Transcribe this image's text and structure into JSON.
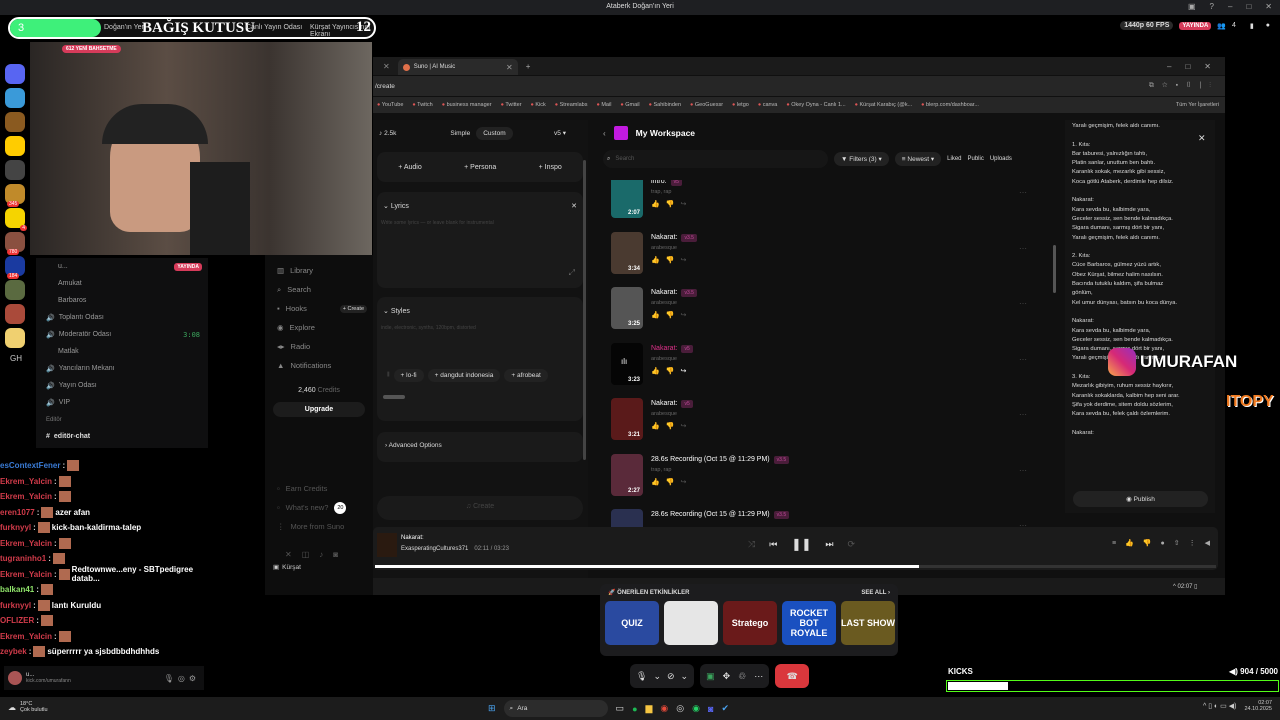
{
  "discord_title": "Ataberk Doğan'ın Yeri",
  "donation": {
    "left_value": "3",
    "title": "BAĞIŞ KUTUSU",
    "right_value": "12",
    "progress_fraction": 0.25,
    "crumbs": [
      "Doğan'ın Yeri",
      "Canlı Yayın Odası",
      "Kürşat Yayıncısının Ekranı"
    ]
  },
  "stream": {
    "quality": "1440p 60 FPS",
    "live": "YAYINDA",
    "viewers": "4",
    "new_sub": "612 YENİ BAHSETME"
  },
  "servers": {
    "badges": [
      "345",
      "4",
      "780",
      "184"
    ],
    "gh": "GH"
  },
  "channels": {
    "live_badge": "YAYINDA",
    "users": [
      "u...",
      "Amukat",
      "Barbaros"
    ],
    "rooms": [
      {
        "name": "Toplantı Odası"
      },
      {
        "name": "Moderatör Odası",
        "time": "3:08"
      },
      {
        "name": "Matlak",
        "user": true
      },
      {
        "name": "Yancıların Mekanı"
      },
      {
        "name": "Yayın Odası"
      },
      {
        "name": "VIP"
      }
    ],
    "category": "Editör",
    "text_channel": "editör-chat"
  },
  "chat": [
    {
      "user": "esContextFener",
      "color": "u-blue",
      "text": ""
    },
    {
      "user": "Ekrem_Yalcin",
      "color": "u-red",
      "text": ""
    },
    {
      "user": "Ekrem_Yalcin",
      "color": "u-red",
      "text": ""
    },
    {
      "user": "eren1077",
      "color": "u-red",
      "text": "azer afan"
    },
    {
      "user": "furknyyl",
      "color": "u-red",
      "text": "kick-ban-kaldirma-talep"
    },
    {
      "user": "Ekrem_Yalcin",
      "color": "u-red",
      "text": ""
    },
    {
      "user": "tugraninho1",
      "color": "u-red",
      "text": ""
    },
    {
      "user": "Ekrem_Yalcin",
      "color": "u-red",
      "text": "Redtownwe...eny - SBTpedigree datab..."
    },
    {
      "user": "balkan41",
      "color": "u-green",
      "text": ""
    },
    {
      "user": "furknyyl",
      "color": "u-red",
      "text": "lantı Kuruldu"
    },
    {
      "user": "OFLIZER",
      "color": "u-red",
      "text": ""
    },
    {
      "user": "Ekrem_Yalcin",
      "color": "u-red",
      "text": ""
    },
    {
      "user": "zeybek",
      "color": "u-red",
      "text": "süperrrrr ya sjsbdbbdhdhhds"
    }
  ],
  "discord_user": {
    "name": "u...",
    "status": "kick.com/umurafann"
  },
  "suno_sidebar": {
    "items": [
      "Library",
      "Search",
      "Hooks",
      "Explore",
      "Radio",
      "Notifications"
    ],
    "create_badge": "+ Create",
    "credits_num": "2,460",
    "credits_label": "Credits",
    "upgrade": "Upgrade",
    "footer": [
      "Earn Credits",
      "What's new?",
      "More from Suno"
    ],
    "whats_new_count": "20",
    "taskbar_user": "Kürşat"
  },
  "browser": {
    "tab_title": "Suno | AI Music",
    "url": "/create",
    "bookmarks": [
      "YouTube",
      "Twitch",
      "business manager",
      "Twitter",
      "Kick",
      "Streamlabs",
      "Mail",
      "Gmail",
      "Sahibinden",
      "GeoGuessr",
      "letgo",
      "canva",
      "Okey Oyna - Canlı 1...",
      "Kürşat Karabıç (@k...",
      "blerp.com/dashboar..."
    ],
    "all_bookmarks": "Tüm Yer İşaretleri"
  },
  "create_panel": {
    "notes": "2.5k",
    "mode_simple": "Simple",
    "mode_custom": "Custom",
    "version": "v5",
    "adds": [
      "Audio",
      "Persona",
      "Inspo"
    ],
    "lyrics_label": "Lyrics",
    "lyrics_placeholder": "Write some lyrics — or leave blank for instrumental",
    "styles_label": "Styles",
    "styles_placeholder": "indie, electronic, synths, 120bpm, distorted",
    "style_tags": [
      "lo-fi",
      "dangdut indonesia",
      "afrobeat"
    ],
    "advanced": "Advanced Options",
    "create_btn": "Create"
  },
  "workspace": {
    "title": "My Workspace",
    "search_placeholder": "Search",
    "filters": "Filters (3)",
    "sort": "Newest",
    "tabs": [
      "Liked",
      "Public",
      "Uploads"
    ],
    "songs": [
      {
        "title": "intro:",
        "tag": "v5",
        "sub": "trap, rap",
        "dur": "2:07",
        "color": "#1a6a6a"
      },
      {
        "title": "Nakarat:",
        "tag": "v3.5",
        "sub": "arabesque",
        "dur": "3:34",
        "color": "#4a3a30"
      },
      {
        "title": "Nakarat:",
        "tag": "v3.5",
        "sub": "arabesque",
        "dur": "3:25",
        "color": "#555"
      },
      {
        "title": "Nakarat:",
        "tag": "v5",
        "sub": "arabesque",
        "dur": "3:23",
        "color": "#050505",
        "active": true
      },
      {
        "title": "Nakarat:",
        "tag": "v5",
        "sub": "arabesque",
        "dur": "3:21",
        "color": "#5a1a1a"
      },
      {
        "title": "28.6s Recording (Oct 15 @ 11:29 PM)",
        "tag": "v3.5",
        "sub": "trap, rap",
        "dur": "2:27",
        "color": "#5a2a3a"
      },
      {
        "title": "28.6s Recording (Oct 15 @ 11:29 PM)",
        "tag": "v3.5",
        "sub": "",
        "dur": "",
        "color": "#2a3050"
      }
    ]
  },
  "lyrics_panel": {
    "lines": [
      "Yaralı geçmişim, felek aldı canımı.",
      "",
      "1. Kıta:",
      "Bar taburesi, yalnızlığın tahtı,",
      "Platin sanlar, unuttum ben bahtı.",
      "Karanlık sokak, mezarlık gibi sessiz,",
      "Koca götlü Ataberk, derdimle hep dilsiz.",
      "",
      "Nakarat:",
      "Kara sevda bu, kalbimde yara,",
      "Geceler sessiz, sen bende kalmadıkça.",
      "Sigara dumanı, sarmış dört bir yanı,",
      "Yaralı geçmişim, felek aldı canımı.",
      "",
      "2. Kıta:",
      "Cüce Barbaros, gülmez yüzü artık,",
      "Obez Kürşat, bilmez halim nasılsın.",
      "Bacında tutuklu kaldım, şifa bulmaz",
      "gönlüm,",
      "Kel umur dünyası, batsın bu koca dünya.",
      "",
      "Nakarat:",
      "Kara sevda bu, kalbimde yara,",
      "Geceler sessiz, sen bende kalmadıkça.",
      "Sigara dumanı, sarmış dört bir yanı,",
      "Yaralı geçmişim, felek aldı canımı.",
      "",
      "3. Kıta:",
      "Mezarlık gibiyim, ruhum sessiz haykırır,",
      "Karanlık sokaklarda, kalbim hep seni arar.",
      "Şifa yok derdime, sitem doldu sözlerim,",
      "Kara sevda bu, felek çaldı özlemlerim.",
      "",
      "Nakarat:"
    ],
    "publish": "Publish"
  },
  "overlay": {
    "instagram": "UMURAFAN",
    "brand": "ITOPY"
  },
  "player": {
    "title": "Nakarat:",
    "artist": "ExasperatingCultures371",
    "current": "02:11",
    "total": "03:23",
    "progress_fraction": 0.647
  },
  "inner_taskbar": {
    "time": "02:07"
  },
  "events": {
    "title": "ÖNERİLEN ETKİNLİKLER",
    "see_all": "SEE ALL",
    "games": [
      {
        "name": "QUIZ",
        "color": "#2a4aa0"
      },
      {
        "name": "",
        "color": "#e6e6e6"
      },
      {
        "name": "Stratego",
        "color": "#6a1a1a"
      },
      {
        "name": "ROCKET BOT ROYALE",
        "color": "#1a50c0"
      },
      {
        "name": "LAST SHOW",
        "color": "#6a5a20"
      }
    ]
  },
  "kicks": {
    "label": "KICKS",
    "current": "904",
    "goal": "5000",
    "progress_fraction": 0.18
  },
  "windows": {
    "weather_temp": "18°C",
    "weather_desc": "Çok bulutlu",
    "search": "Ara",
    "time": "02:07",
    "date": "24.10.2025"
  }
}
